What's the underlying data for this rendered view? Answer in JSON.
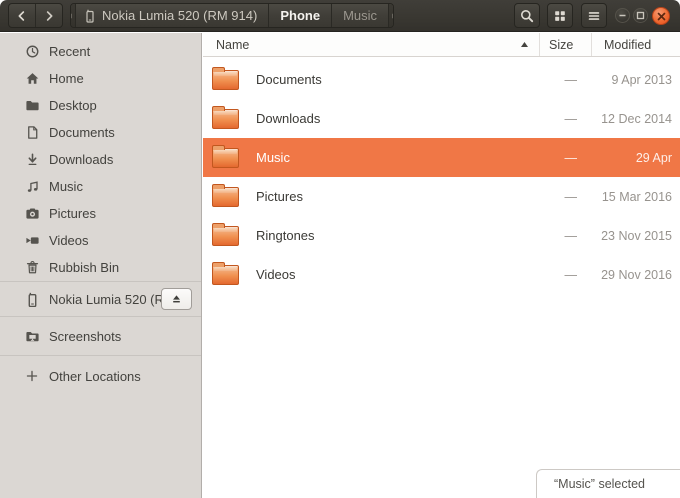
{
  "headerbar": {
    "breadcrumbs": {
      "device": "Nokia Lumia 520 (RM 914)",
      "current": "Phone",
      "next": "Music"
    },
    "icons": {
      "back": "chevron-left",
      "forward": "chevron-right",
      "path_scroll_left": "triangle-left",
      "path_scroll_right": "triangle-right",
      "search": "magnifier",
      "view": "grid",
      "menu": "hamburger",
      "minimize": "minus-circle",
      "maximize": "square-circle",
      "close": "x-circle"
    }
  },
  "sidebar": {
    "items": [
      {
        "label": "Recent",
        "icon": "clock-icon"
      },
      {
        "label": "Home",
        "icon": "home-icon"
      },
      {
        "label": "Desktop",
        "icon": "folder-icon"
      },
      {
        "label": "Documents",
        "icon": "document-icon"
      },
      {
        "label": "Downloads",
        "icon": "download-arrow-icon"
      },
      {
        "label": "Music",
        "icon": "music-note-icon"
      },
      {
        "label": "Pictures",
        "icon": "camera-icon"
      },
      {
        "label": "Videos",
        "icon": "video-camera-icon"
      },
      {
        "label": "Rubbish Bin",
        "icon": "trash-icon"
      }
    ],
    "device": {
      "label": "Nokia Lumia 520 (R…",
      "icon": "phone-icon",
      "eject_icon": "eject-icon"
    },
    "bookmark": {
      "label": "Screenshots",
      "icon": "screenshot-folder-icon"
    },
    "other_locations": {
      "label": "Other Locations",
      "icon": "plus-icon"
    }
  },
  "list": {
    "columns": {
      "name": "Name",
      "size": "Size",
      "modified": "Modified"
    },
    "sort": {
      "column": "Name",
      "direction": "ascending"
    },
    "rows": [
      {
        "name": "Documents",
        "size": "—",
        "modified": "9 Apr 2013"
      },
      {
        "name": "Downloads",
        "size": "—",
        "modified": "12 Dec 2014"
      },
      {
        "name": "Music",
        "size": "—",
        "modified": "29 Apr"
      },
      {
        "name": "Pictures",
        "size": "—",
        "modified": "15 Mar 2016"
      },
      {
        "name": "Ringtones",
        "size": "—",
        "modified": "23 Nov 2015"
      },
      {
        "name": "Videos",
        "size": "—",
        "modified": "29 Nov 2016"
      }
    ],
    "selected_row": "Music"
  },
  "status": {
    "text": "“Music” selected"
  },
  "colors": {
    "selection": "#f07746",
    "close_button": "#e95420",
    "sidebar_bg": "#dbd7d3",
    "headerbar_bg": "#393731"
  }
}
